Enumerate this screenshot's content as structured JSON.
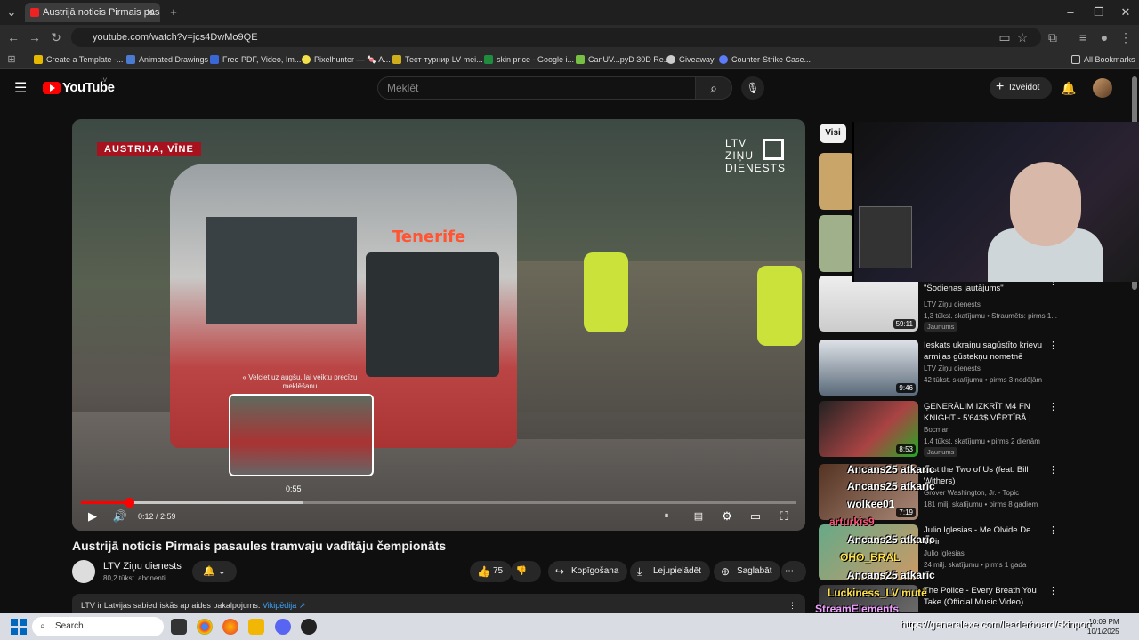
{
  "browser": {
    "tab_title": "Austrijā noticis Pirmais pasaule",
    "url": "youtube.com/watch?v=jcs4DwMo9QE",
    "bookmarks": [
      {
        "label": "Create a Template -...",
        "color": "#e6b800"
      },
      {
        "label": "Animated Drawings",
        "color": "#4a7bd0"
      },
      {
        "label": "Free PDF, Video, Im...",
        "color": "#3a67d8"
      },
      {
        "label": "Pixelhunter — 🍬 A...",
        "color": "#f2e14a"
      },
      {
        "label": "Тест-турнир LV mei...",
        "color": "#cfae1b"
      },
      {
        "label": "skin price - Google i...",
        "color": "#1e8e3e"
      },
      {
        "label": "CanUV...pyD 30D Re...",
        "color": "#76c043"
      },
      {
        "label": "Giveaway",
        "color": "#cccccc"
      },
      {
        "label": "Counter-Strike Case...",
        "color": "#5c7cfa"
      }
    ],
    "all_bookmarks": "All Bookmarks"
  },
  "youtube": {
    "logo_text": "YouTube",
    "region": "LV",
    "search_placeholder": "Meklēt",
    "create_label": "Izveidot"
  },
  "video": {
    "place_label": "AUSTRIJA, VĪNE",
    "ltv_logo": "LTV\nZIŅU\nDIENESTS",
    "tram_destination": "Tenerife",
    "seek_hint": "« Velciet uz augšu, lai veiktu precīzu meklēšanu",
    "preview_time": "0:55",
    "time_display": "0:12 / 2:59",
    "progress_fraction": 0.067,
    "hover_fraction": 0.31,
    "title": "Austrijā noticis Pirmais pasaules tramvaju vadītāju čempionāts",
    "channel": "LTV Ziņu dienests",
    "subscribers": "80,2 tūkst. abonenti",
    "likes": "75",
    "share_label": "Kopīgošana",
    "download_label": "Lejupielādēt",
    "save_label": "Saglabāt",
    "description_text": "LTV ir Latvijas sabiedriskās apraides pakalpojums.",
    "description_link": "Vikipēdija ↗"
  },
  "sidebar": {
    "chip_all": "Visi",
    "items": [
      {
        "title": "\"Šodienas jautājums\"",
        "channel": "LTV Ziņu dienests",
        "meta": "1,3 tūkst. skatījumu • Straumēts: pirms 1...",
        "badge": "Jaunums",
        "duration": "59:11"
      },
      {
        "title": "Ieskats ukraiņu sagūstīto krievu armijas gūstekņu nometnē",
        "channel": "LTV Ziņu dienests",
        "meta": "42 tūkst. skatījumu • pirms 3 nedēļām",
        "badge": "",
        "duration": "9:46"
      },
      {
        "title": "ĢENERĀLIM IZKRĪT M4 FN KNIGHT - 5'643$ VĒRTĪBĀ | ...",
        "channel": "Bocman",
        "meta": "1,4 tūkst. skatījumu • pirms 2 dienām",
        "badge": "Jaunums",
        "duration": "8:53"
      },
      {
        "title": "Just the Two of Us (feat. Bill Withers)",
        "channel": "Grover Washington, Jr. - Topic",
        "meta": "181 milj. skatījumu • pirms 8 gadiem",
        "badge": "",
        "duration": "7:19"
      },
      {
        "title": "Julio Iglesias - Me Olvide De Vivir",
        "channel": "Julio Iglesias",
        "meta": "24 milj. skatījumu • pirms 1 gada",
        "badge": "",
        "duration": ""
      },
      {
        "title": "The Police - Every Breath You Take (Official Music Video)",
        "channel": "",
        "meta": "",
        "badge": "",
        "duration": ""
      }
    ]
  },
  "stream_overlay": {
    "chat": [
      "Ancans25 atkarīc",
      "Ancans25 atkarīc",
      "wolkee01",
      "arturkis9",
      "Ancans25 atkarīc",
      "OHO_BRAL",
      "Ancans25 atkarīc",
      "Luckiness_LV mutē",
      "StreamElements"
    ],
    "source_url": "https://generalexe.com/leaderboard/skinport"
  },
  "taskbar": {
    "search_label": "Search",
    "time": "10:09 PM",
    "date": "10/1/2025"
  }
}
